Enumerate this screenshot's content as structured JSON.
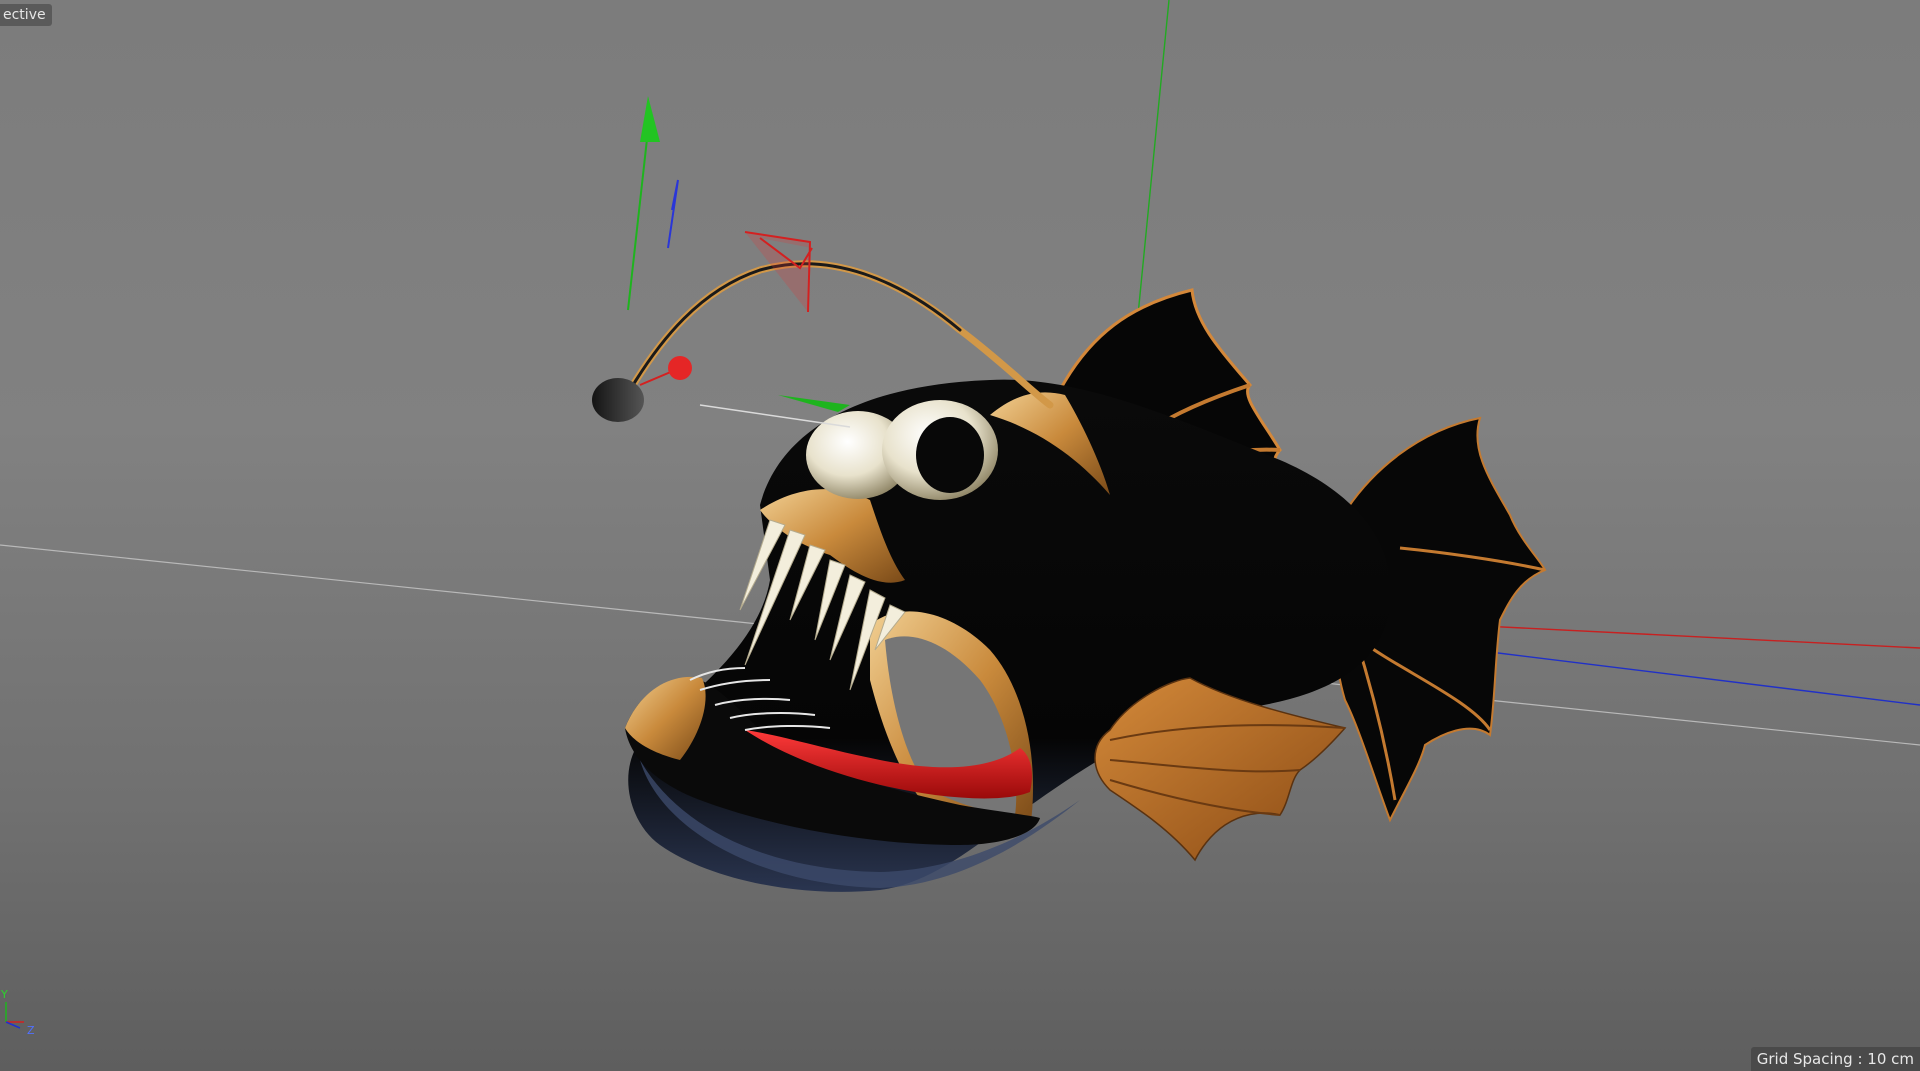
{
  "viewport": {
    "label": "ective",
    "grid_spacing": "Grid Spacing : 10 cm"
  },
  "axis_gizmo": {
    "y_label": "Y",
    "z_label": "Z"
  },
  "colors": {
    "x_axis": "#d42020",
    "y_axis": "#1eb41e",
    "z_axis": "#2030d0",
    "fish_body": "#050505",
    "fish_accent": "#c88a3a",
    "tongue": "#d51a1a"
  }
}
